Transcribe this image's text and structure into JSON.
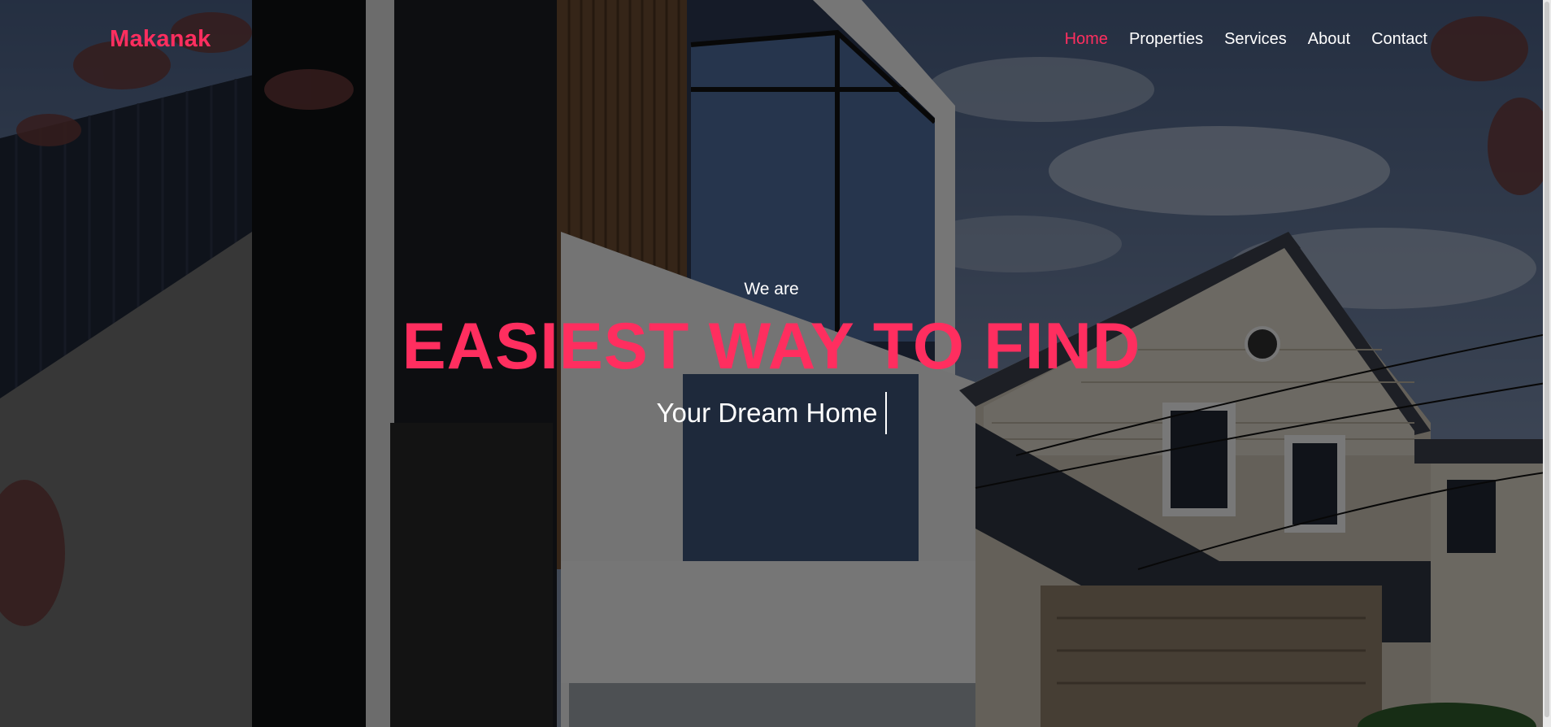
{
  "brand": {
    "name": "Makanak",
    "color": "#ff2e5f"
  },
  "nav": {
    "items": [
      {
        "label": "Home",
        "active": true
      },
      {
        "label": "Properties",
        "active": false
      },
      {
        "label": "Services",
        "active": false
      },
      {
        "label": "About",
        "active": false
      },
      {
        "label": "Contact",
        "active": false
      }
    ]
  },
  "hero": {
    "intro": "We are",
    "headline": "EASIEST WAY TO FIND",
    "typed_text": "Your Dream Home",
    "background": "modern-houses-photo"
  },
  "colors": {
    "accent": "#ff2e5f",
    "text": "#ffffff"
  }
}
